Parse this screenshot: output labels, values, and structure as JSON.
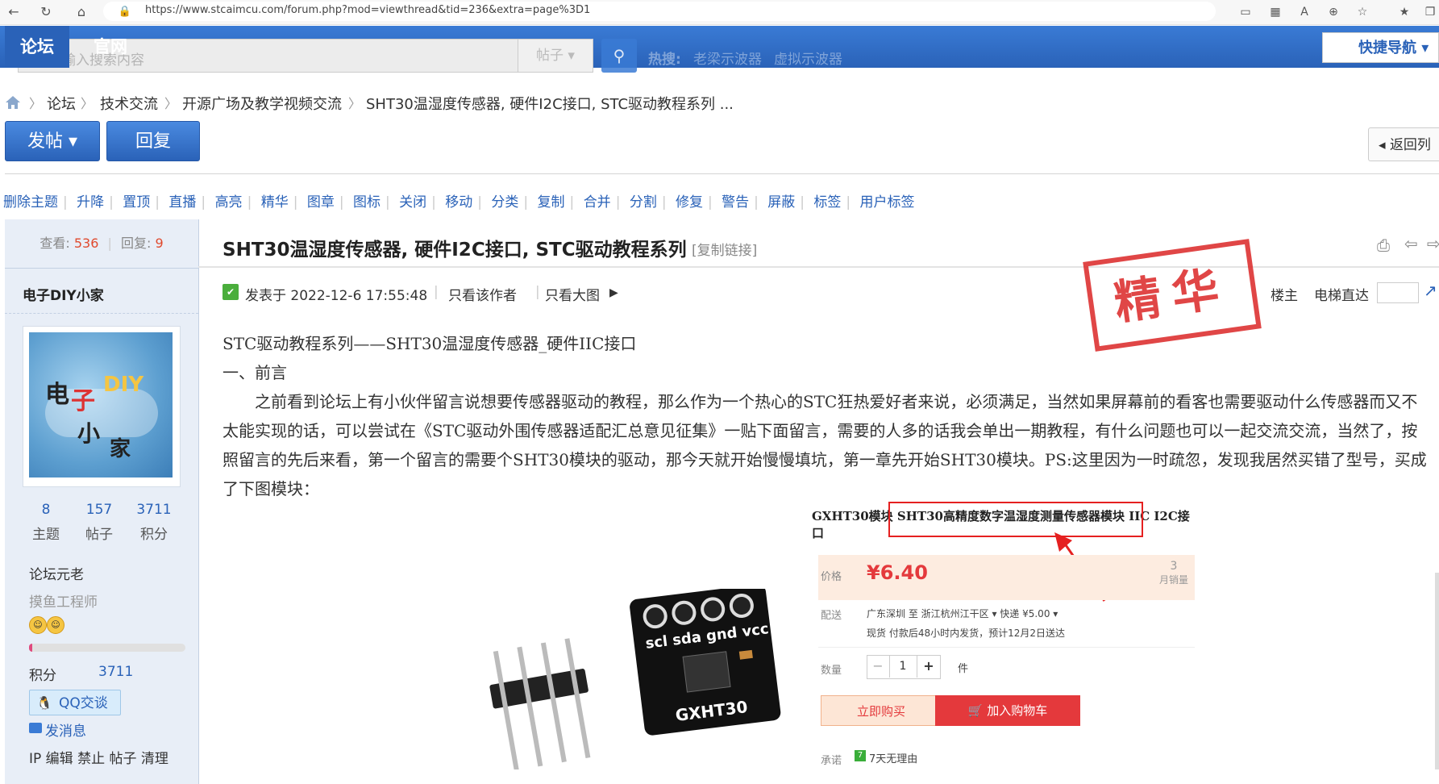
{
  "browser": {
    "url": "https://www.stcaimcu.com/forum.php?mod=viewthread&tid=236&extra=page%3D1"
  },
  "header": {
    "tab_forum": "论坛",
    "tab_official": "官网",
    "search_placeholder": "请输入搜索内容",
    "search_type": "帖子",
    "hot_label": "热搜:",
    "hot_links": [
      "老梁示波器",
      "虚拟示波器"
    ],
    "quick_nav": "快捷导航"
  },
  "breadcrumb": [
    "论坛",
    "技术交流",
    "开源广场及教学视频交流",
    "SHT30温湿度传感器, 硬件I2C接口, STC驱动教程系列 ..."
  ],
  "toolbar": {
    "post_button": "发帖",
    "reply_button": "回复",
    "back_button": "返回列"
  },
  "mod_actions": [
    "删除主题",
    "升降",
    "置顶",
    "直播",
    "高亮",
    "精华",
    "图章",
    "图标",
    "关闭",
    "移动",
    "分类",
    "复制",
    "合并",
    "分割",
    "修复",
    "警告",
    "屏蔽",
    "标签",
    "用户标签"
  ],
  "thread": {
    "views_label": "查看:",
    "views": "536",
    "replies_label": "回复:",
    "replies": "9",
    "title": "SHT30温湿度传感器, 硬件I2C接口, STC驱动教程系列",
    "copy_link": "[复制链接]"
  },
  "author": {
    "name": "电子DIY小家",
    "avatar_text": [
      "电",
      "子",
      "DIY",
      "小",
      "家"
    ],
    "stats": [
      {
        "value": "8",
        "label": "主题"
      },
      {
        "value": "157",
        "label": "帖子"
      },
      {
        "value": "3711",
        "label": "积分"
      }
    ],
    "rank_title": "论坛元老",
    "rank_sub": "摸鱼工程师",
    "score_label": "积分",
    "score_value": "3711",
    "qq_button": "QQ交谈",
    "send_message": "发消息",
    "admin_links": "IP 编辑 禁止 帖子 清理"
  },
  "post": {
    "posted_at": "发表于 2022-12-6 17:55:48",
    "only_author": "只看该作者",
    "big_image": "只看大图",
    "floor_label": "楼主",
    "elevator": "电梯直达",
    "stamp": "精华",
    "lines": [
      "STC驱动教程系列——SHT30温湿度传感器_硬件IIC接口",
      "一、前言"
    ],
    "paragraph": "之前看到论坛上有小伙伴留言说想要传感器驱动的教程，那么作为一个热心的STC狂热爱好者来说，必须满足，当然如果屏幕前的看客也需要驱动什么传感器而又不太能实现的话，可以尝试在《STC驱动外围传感器适配汇总意见征集》一贴下面留言，需要的人多的话我会单出一期教程，有什么问题也可以一起交流交流，当然了，按照留言的先后来看，第一个留言的需要个SHT30模块的驱动，那今天就开始慢慢填坑，第一章先开始SHT30模块。PS:这里因为一时疏忽，发现我居然买错了型号，买成了下图模块："
  },
  "product": {
    "title_prefix": "GXHT30模块",
    "title_highlight": "SHT30高精度数字温湿度测量传感器模块",
    "title_suffix": "IIC I2C接口",
    "price_label": "价格",
    "price": "¥6.40",
    "sold_count": "3",
    "sold_label": "月销量",
    "ship_label": "配送",
    "ship_route": "广东深圳 至 浙江杭州江干区 ▾  快递 ¥5.00 ▾",
    "ship_note": "现货 付款后48小时内发货，预计12月2日送达",
    "qty_label": "数量",
    "qty": "1",
    "qty_unit": "件",
    "buy_now": "立即购买",
    "add_cart": "加入购物车",
    "promise_label": "承诺",
    "promise": "7天无理由",
    "board_pins": "scl sda gnd vcc",
    "board_label": "GXHT30"
  }
}
